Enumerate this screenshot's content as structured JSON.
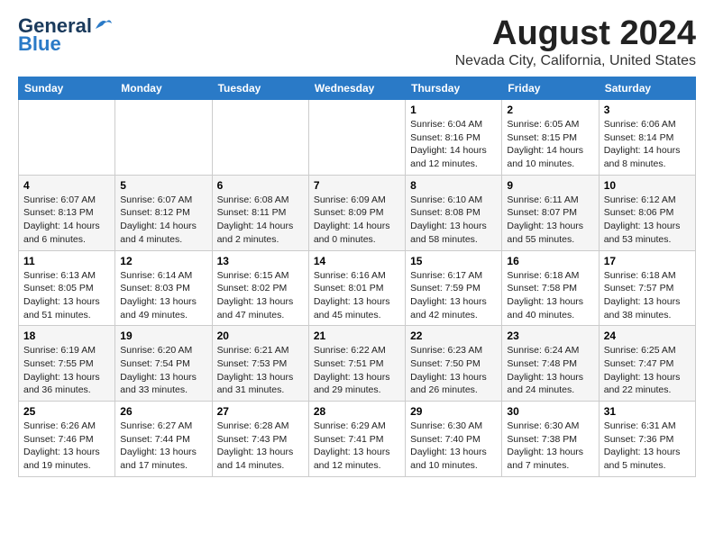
{
  "logo": {
    "part1": "General",
    "part2": "Blue"
  },
  "title": "August 2024",
  "location": "Nevada City, California, United States",
  "days_header": [
    "Sunday",
    "Monday",
    "Tuesday",
    "Wednesday",
    "Thursday",
    "Friday",
    "Saturday"
  ],
  "weeks": [
    [
      {
        "day": "",
        "info": ""
      },
      {
        "day": "",
        "info": ""
      },
      {
        "day": "",
        "info": ""
      },
      {
        "day": "",
        "info": ""
      },
      {
        "day": "1",
        "info": "Sunrise: 6:04 AM\nSunset: 8:16 PM\nDaylight: 14 hours\nand 12 minutes."
      },
      {
        "day": "2",
        "info": "Sunrise: 6:05 AM\nSunset: 8:15 PM\nDaylight: 14 hours\nand 10 minutes."
      },
      {
        "day": "3",
        "info": "Sunrise: 6:06 AM\nSunset: 8:14 PM\nDaylight: 14 hours\nand 8 minutes."
      }
    ],
    [
      {
        "day": "4",
        "info": "Sunrise: 6:07 AM\nSunset: 8:13 PM\nDaylight: 14 hours\nand 6 minutes."
      },
      {
        "day": "5",
        "info": "Sunrise: 6:07 AM\nSunset: 8:12 PM\nDaylight: 14 hours\nand 4 minutes."
      },
      {
        "day": "6",
        "info": "Sunrise: 6:08 AM\nSunset: 8:11 PM\nDaylight: 14 hours\nand 2 minutes."
      },
      {
        "day": "7",
        "info": "Sunrise: 6:09 AM\nSunset: 8:09 PM\nDaylight: 14 hours\nand 0 minutes."
      },
      {
        "day": "8",
        "info": "Sunrise: 6:10 AM\nSunset: 8:08 PM\nDaylight: 13 hours\nand 58 minutes."
      },
      {
        "day": "9",
        "info": "Sunrise: 6:11 AM\nSunset: 8:07 PM\nDaylight: 13 hours\nand 55 minutes."
      },
      {
        "day": "10",
        "info": "Sunrise: 6:12 AM\nSunset: 8:06 PM\nDaylight: 13 hours\nand 53 minutes."
      }
    ],
    [
      {
        "day": "11",
        "info": "Sunrise: 6:13 AM\nSunset: 8:05 PM\nDaylight: 13 hours\nand 51 minutes."
      },
      {
        "day": "12",
        "info": "Sunrise: 6:14 AM\nSunset: 8:03 PM\nDaylight: 13 hours\nand 49 minutes."
      },
      {
        "day": "13",
        "info": "Sunrise: 6:15 AM\nSunset: 8:02 PM\nDaylight: 13 hours\nand 47 minutes."
      },
      {
        "day": "14",
        "info": "Sunrise: 6:16 AM\nSunset: 8:01 PM\nDaylight: 13 hours\nand 45 minutes."
      },
      {
        "day": "15",
        "info": "Sunrise: 6:17 AM\nSunset: 7:59 PM\nDaylight: 13 hours\nand 42 minutes."
      },
      {
        "day": "16",
        "info": "Sunrise: 6:18 AM\nSunset: 7:58 PM\nDaylight: 13 hours\nand 40 minutes."
      },
      {
        "day": "17",
        "info": "Sunrise: 6:18 AM\nSunset: 7:57 PM\nDaylight: 13 hours\nand 38 minutes."
      }
    ],
    [
      {
        "day": "18",
        "info": "Sunrise: 6:19 AM\nSunset: 7:55 PM\nDaylight: 13 hours\nand 36 minutes."
      },
      {
        "day": "19",
        "info": "Sunrise: 6:20 AM\nSunset: 7:54 PM\nDaylight: 13 hours\nand 33 minutes."
      },
      {
        "day": "20",
        "info": "Sunrise: 6:21 AM\nSunset: 7:53 PM\nDaylight: 13 hours\nand 31 minutes."
      },
      {
        "day": "21",
        "info": "Sunrise: 6:22 AM\nSunset: 7:51 PM\nDaylight: 13 hours\nand 29 minutes."
      },
      {
        "day": "22",
        "info": "Sunrise: 6:23 AM\nSunset: 7:50 PM\nDaylight: 13 hours\nand 26 minutes."
      },
      {
        "day": "23",
        "info": "Sunrise: 6:24 AM\nSunset: 7:48 PM\nDaylight: 13 hours\nand 24 minutes."
      },
      {
        "day": "24",
        "info": "Sunrise: 6:25 AM\nSunset: 7:47 PM\nDaylight: 13 hours\nand 22 minutes."
      }
    ],
    [
      {
        "day": "25",
        "info": "Sunrise: 6:26 AM\nSunset: 7:46 PM\nDaylight: 13 hours\nand 19 minutes."
      },
      {
        "day": "26",
        "info": "Sunrise: 6:27 AM\nSunset: 7:44 PM\nDaylight: 13 hours\nand 17 minutes."
      },
      {
        "day": "27",
        "info": "Sunrise: 6:28 AM\nSunset: 7:43 PM\nDaylight: 13 hours\nand 14 minutes."
      },
      {
        "day": "28",
        "info": "Sunrise: 6:29 AM\nSunset: 7:41 PM\nDaylight: 13 hours\nand 12 minutes."
      },
      {
        "day": "29",
        "info": "Sunrise: 6:30 AM\nSunset: 7:40 PM\nDaylight: 13 hours\nand 10 minutes."
      },
      {
        "day": "30",
        "info": "Sunrise: 6:30 AM\nSunset: 7:38 PM\nDaylight: 13 hours\nand 7 minutes."
      },
      {
        "day": "31",
        "info": "Sunrise: 6:31 AM\nSunset: 7:36 PM\nDaylight: 13 hours\nand 5 minutes."
      }
    ]
  ]
}
